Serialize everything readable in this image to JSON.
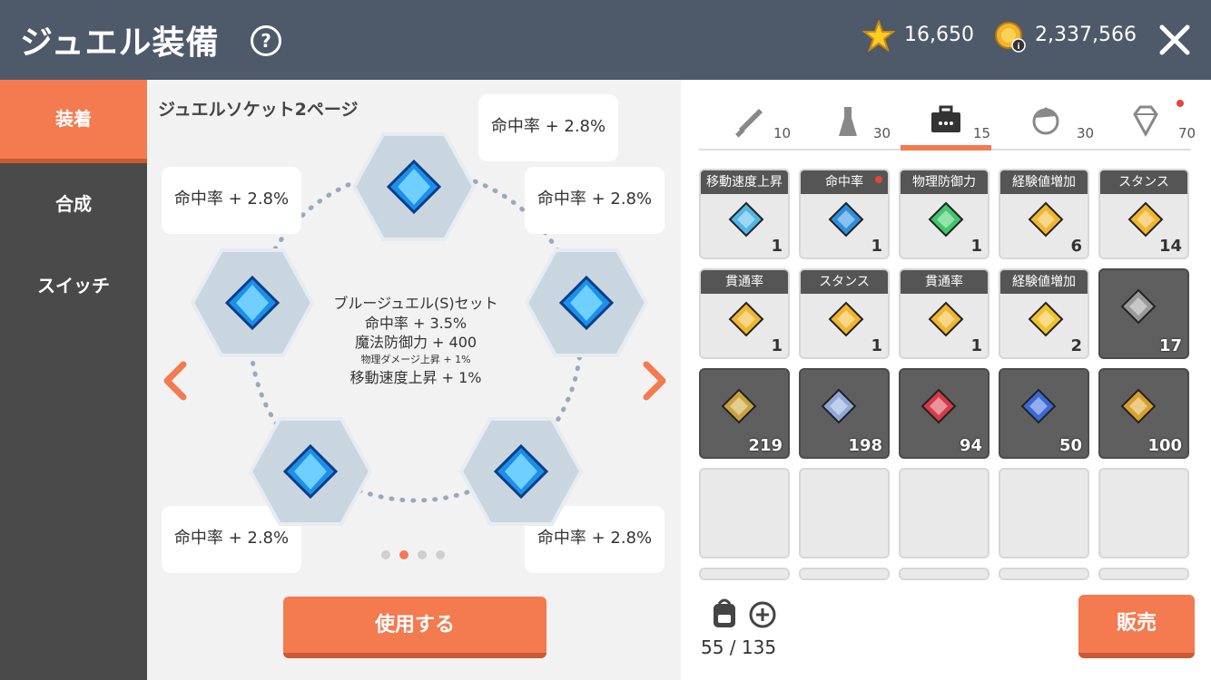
{
  "header": {
    "title": "ジュエル装備",
    "help_icon": "question-icon",
    "stars": "16,650",
    "coins": "2,337,566"
  },
  "sidebar": {
    "items": [
      {
        "label": "装着",
        "active": true
      },
      {
        "label": "合成",
        "active": false
      },
      {
        "label": "スイッチ",
        "active": false
      }
    ]
  },
  "socket": {
    "page_title": "ジュエルソケット2ページ",
    "slots": [
      {
        "bonus": "命中率 + 2.8%"
      },
      {
        "bonus": "命中率 + 2.8%"
      },
      {
        "bonus": "命中率 + 2.8%"
      },
      {
        "bonus": "命中率 + 2.8%"
      },
      {
        "bonus": "命中率 + 2.8%"
      },
      {
        "bonus": "命中率 + 2.8%"
      }
    ],
    "set_name": "ブルージュエル(S)セット",
    "set_effects": [
      "命中率 + 3.5%",
      "魔法防御力 + 400",
      "物理ダメージ上昇 + 1%",
      "移動速度上昇 + 1%"
    ],
    "page_dots": 4,
    "current_page": 2,
    "use_button": "使用する"
  },
  "inventory": {
    "tabs": [
      {
        "icon": "sword-icon",
        "count": "10"
      },
      {
        "icon": "potion-icon",
        "count": "30"
      },
      {
        "icon": "toolbox-icon",
        "count": "15",
        "active": true
      },
      {
        "icon": "character-icon",
        "count": "30"
      },
      {
        "icon": "diamond-icon",
        "count": "70",
        "badge": true
      }
    ],
    "rows": [
      [
        {
          "label": "移動速度上昇",
          "qty": "1",
          "gem": "#4fb6e8"
        },
        {
          "label": "命中率",
          "qty": "1",
          "gem": "#2a8fe0",
          "badge": true
        },
        {
          "label": "物理防御力",
          "qty": "1",
          "gem": "#3fc76a"
        },
        {
          "label": "経験値増加",
          "qty": "6",
          "gem": "#f2b52a"
        },
        {
          "label": "スタンス",
          "qty": "14",
          "gem": "#f2b52a"
        }
      ],
      [
        {
          "label": "貫通率",
          "qty": "1",
          "gem": "#f2b52a"
        },
        {
          "label": "スタンス",
          "qty": "1",
          "gem": "#f2b52a"
        },
        {
          "label": "貫通率",
          "qty": "1",
          "gem": "#f2b52a"
        },
        {
          "label": "経験値増加",
          "qty": "2",
          "gem": "#f2c12a"
        },
        {
          "label": "",
          "qty": "17",
          "gem": "#9a9a9a",
          "dark": true
        }
      ],
      [
        {
          "label": "",
          "qty": "219",
          "gem": "#c9a23a",
          "dark": true
        },
        {
          "label": "",
          "qty": "198",
          "gem": "#8fa8d8",
          "dark": true
        },
        {
          "label": "",
          "qty": "94",
          "gem": "#d83a4a",
          "dark": true
        },
        {
          "label": "",
          "qty": "50",
          "gem": "#3a6ad8",
          "dark": true
        },
        {
          "label": "",
          "qty": "100",
          "gem": "#d8a02a",
          "dark": true
        }
      ]
    ],
    "bag_count": "55 / 135",
    "sell_button": "販売"
  }
}
